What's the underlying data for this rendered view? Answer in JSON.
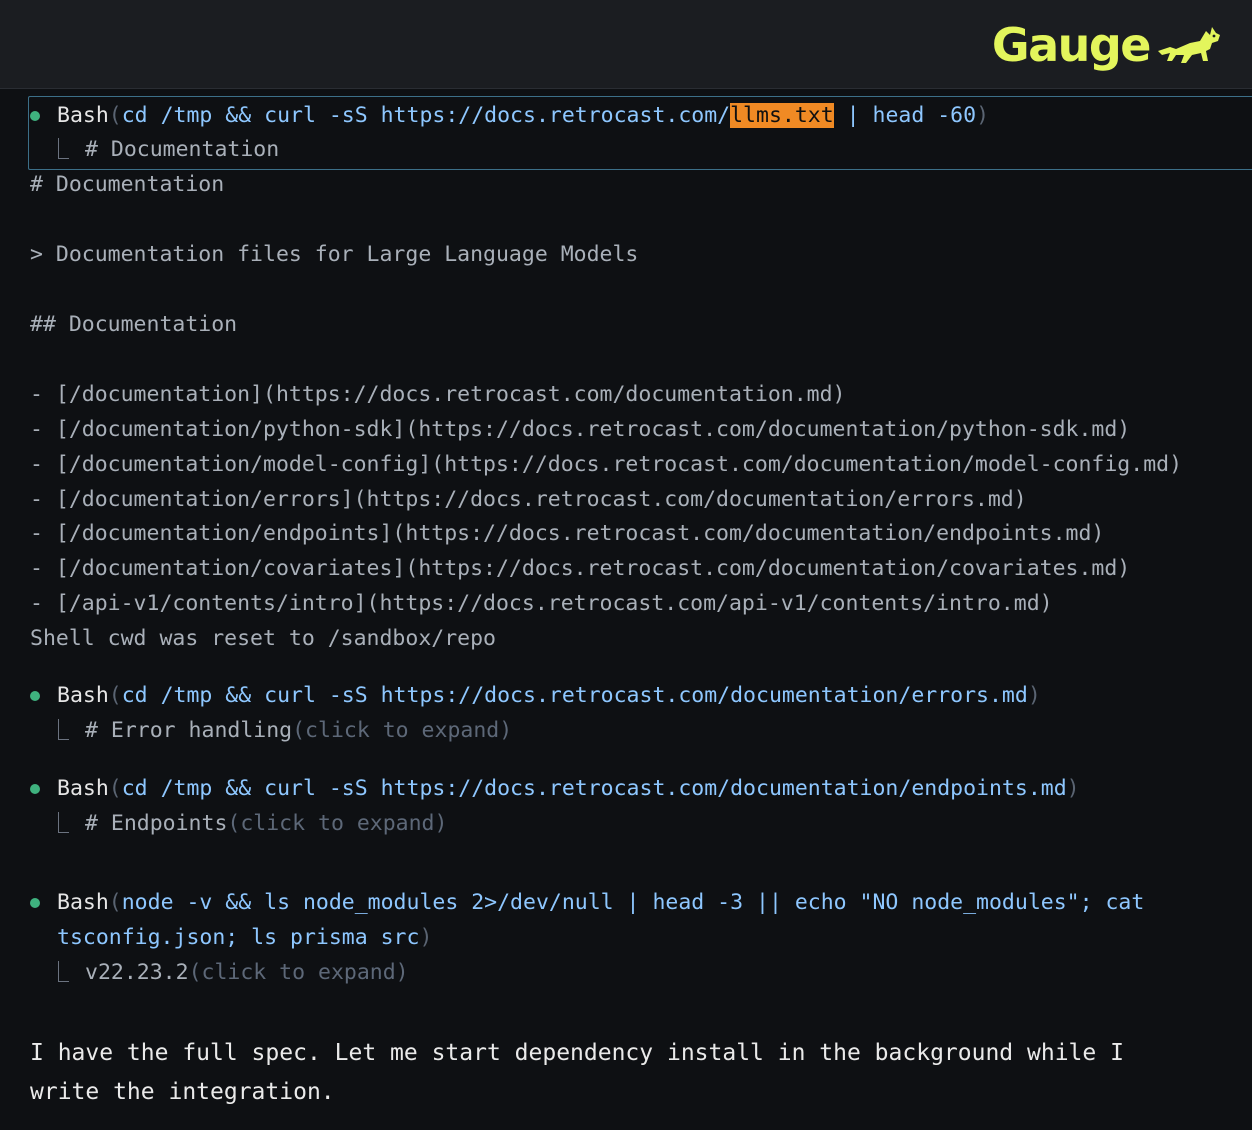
{
  "brand": {
    "name": "Gauge",
    "logo_icon": "dog-icon",
    "accent": "#e3f55c"
  },
  "colors": {
    "status_dot": "#3fb27f",
    "highlight": "#f08a24",
    "command": "#8ec7ff",
    "selection_border": "#3c6f88"
  },
  "call1": {
    "tool": "Bash",
    "cmd_before": "cd /tmp && curl -sS https://docs.retrocast.com/",
    "cmd_highlight": "llms.txt",
    "cmd_after": " | head -60",
    "result_summary": "# Documentation"
  },
  "output": {
    "h1": "# Documentation",
    "quote": "> Documentation files for Large Language Models",
    "h2": "## Documentation",
    "links": [
      "- [/documentation](https://docs.retrocast.com/documentation.md)",
      "- [/documentation/python-sdk](https://docs.retrocast.com/documentation/python-sdk.md)",
      "- [/documentation/model-config](https://docs.retrocast.com/documentation/model-config.md)",
      "- [/documentation/errors](https://docs.retrocast.com/documentation/errors.md)",
      "- [/documentation/endpoints](https://docs.retrocast.com/documentation/endpoints.md)",
      "- [/documentation/covariates](https://docs.retrocast.com/documentation/covariates.md)",
      "- [/api-v1/contents/intro](https://docs.retrocast.com/api-v1/contents/intro.md)"
    ],
    "cwd_note": "Shell cwd was reset to /sandbox/repo"
  },
  "call2": {
    "tool": "Bash",
    "cmd": "cd /tmp && curl -sS https://docs.retrocast.com/documentation/errors.md",
    "result_summary": "# Error handling",
    "expand_hint": "(click to expand)"
  },
  "call3": {
    "tool": "Bash",
    "cmd": "cd /tmp && curl -sS https://docs.retrocast.com/documentation/endpoints.md",
    "result_summary": "# Endpoints",
    "expand_hint": "(click to expand)"
  },
  "call4": {
    "tool": "Bash",
    "cmd_line1": "node -v && ls node_modules 2>/dev/null | head -3 || echo \"NO node_modules\"; cat",
    "cmd_line2": "tsconfig.json; ls prisma src",
    "result_summary": "v22.23.2",
    "expand_hint": "(click to expand)"
  },
  "assistant_message": {
    "line1": "I have the full spec. Let me start dependency install in the background while I",
    "line2": "write the integration."
  }
}
